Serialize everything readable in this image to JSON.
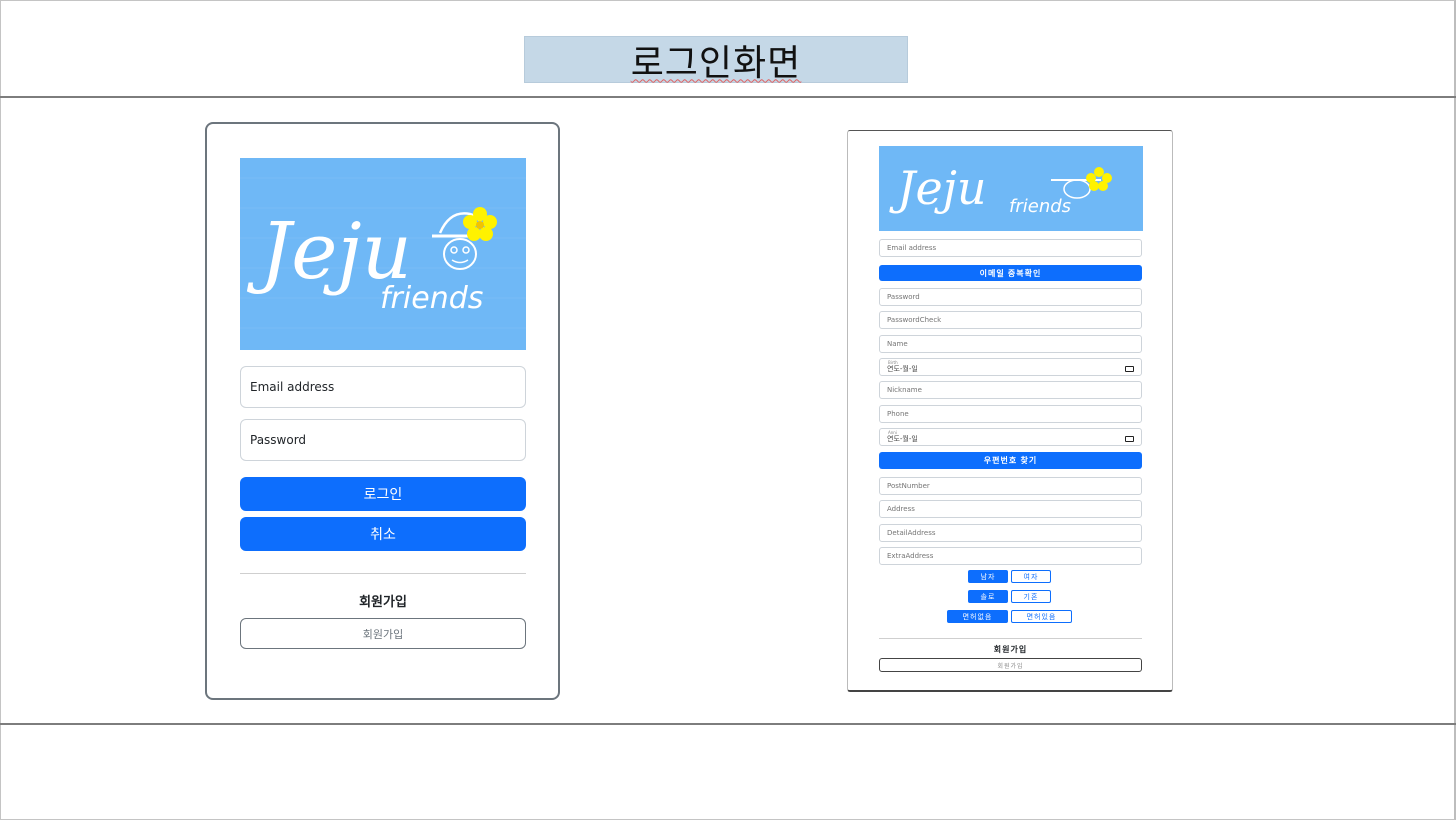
{
  "header": {
    "title": "로그인화면"
  },
  "logo": {
    "word1": "Jeju",
    "word2": "friends",
    "bg_color": "#6fb8f6",
    "flower_color": "#fff200"
  },
  "login": {
    "email_placeholder": "Email address",
    "password_placeholder": "Password",
    "login_label": "로그인",
    "cancel_label": "취소",
    "join_heading": "회원가입",
    "join_button": "회원가입"
  },
  "signup": {
    "email_placeholder": "Email address",
    "email_check_label": "이메일 중복확인",
    "password_placeholder": "Password",
    "password_check_placeholder": "PasswordCheck",
    "name_placeholder": "Name",
    "birth_label": "Birth",
    "birth_value": "연도-월-일",
    "nickname_placeholder": "Nickname",
    "phone_placeholder": "Phone",
    "anni_label": "Anni",
    "anni_value": "연도-월-일",
    "postcode_label": "우편번호 찾기",
    "postnumber_placeholder": "PostNumber",
    "address_placeholder": "Address",
    "detail_address_placeholder": "DetailAddress",
    "extra_address_placeholder": "ExtraAddress",
    "gender": {
      "male": "남자",
      "female": "여자"
    },
    "marital": {
      "single": "솔로",
      "married": "기혼"
    },
    "license": {
      "none": "면허없음",
      "has": "면허있음"
    },
    "join_heading": "회원가입",
    "join_button": "회원가입"
  },
  "colors": {
    "primary": "#0d6efd",
    "title_bg": "#c5d8e7",
    "card_border": "#6c757d"
  }
}
